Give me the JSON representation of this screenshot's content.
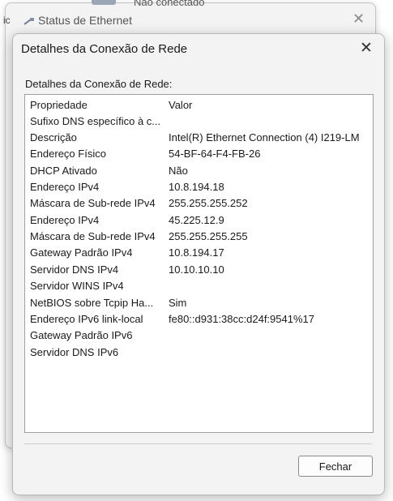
{
  "background_window": {
    "title": "Status de Ethernet",
    "close_glyph": "✕",
    "cut_text": "Não conectado",
    "edge_letter": "ic"
  },
  "dialog": {
    "title": "Detalhes da Conexão de Rede",
    "close_glyph": "✕",
    "group_label": "Detalhes da Conexão de Rede:",
    "columns": {
      "property": "Propriedade",
      "value": "Valor"
    },
    "rows": [
      {
        "property": "Sufixo DNS específico à c...",
        "value": ""
      },
      {
        "property": "Descrição",
        "value": "Intel(R) Ethernet Connection (4) I219-LM"
      },
      {
        "property": "Endereço Físico",
        "value": "54-BF-64-F4-FB-26"
      },
      {
        "property": "DHCP Ativado",
        "value": "Não"
      },
      {
        "property": "Endereço IPv4",
        "value": "10.8.194.18"
      },
      {
        "property": "Máscara de Sub-rede IPv4",
        "value": "255.255.255.252"
      },
      {
        "property": "Endereço IPv4",
        "value": "45.225.12.9"
      },
      {
        "property": "Máscara de Sub-rede IPv4",
        "value": "255.255.255.255"
      },
      {
        "property": "Gateway Padrão IPv4",
        "value": "10.8.194.17"
      },
      {
        "property": "Servidor DNS IPv4",
        "value": "10.10.10.10"
      },
      {
        "property": "Servidor WINS IPv4",
        "value": ""
      },
      {
        "property": "NetBIOS sobre Tcpip Ha...",
        "value": "Sim"
      },
      {
        "property": "Endereço IPv6 link-local",
        "value": "fe80::d931:38cc:d24f:9541%17"
      },
      {
        "property": "Gateway Padrão IPv6",
        "value": ""
      },
      {
        "property": "Servidor DNS IPv6",
        "value": ""
      }
    ],
    "close_button_label": "Fechar"
  }
}
